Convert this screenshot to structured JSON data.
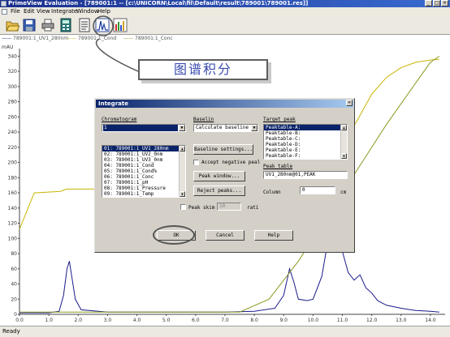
{
  "window": {
    "title": "PrimeView Evaluation - [789001:1 -- [c:\\UNICORN\\Local\\fil\\Default\\result\\789001\\789001.res]]",
    "controls": [
      "_",
      "□",
      "×"
    ]
  },
  "menubar": {
    "items": [
      "File",
      "Edit",
      "View",
      "Integrate",
      "Window",
      "Help"
    ]
  },
  "toolbar": {
    "buttons": [
      "open-folder",
      "save",
      "print",
      "calculator",
      "notes",
      "integrate-peak",
      "report-colors"
    ]
  },
  "legend": {
    "items": [
      "789001:1_UV1_280nm",
      "789001:1_Cond",
      "789001:1_Conc"
    ]
  },
  "chart_data": {
    "type": "line",
    "ylabel": "mAU",
    "yticks": [
      "0",
      "20",
      "40",
      "60",
      "80",
      "100",
      "120",
      "140",
      "160",
      "180",
      "200",
      "220",
      "240",
      "260",
      "280",
      "300",
      "320",
      "340"
    ],
    "xticks": [
      "0.0",
      "1.0",
      "2.0",
      "3.0",
      "4.0",
      "5.0",
      "6.0",
      "7.0",
      "8.0",
      "9.0",
      "10.0",
      "11.0",
      "12.0",
      "13.0",
      "14.0"
    ],
    "xlim": [
      0,
      14.5
    ],
    "ylim": [
      0,
      350
    ],
    "series": [
      {
        "name": "789001:1_UV1_280nm",
        "color": "#1a1a8c",
        "x": [
          0,
          1.0,
          1.35,
          1.5,
          1.62,
          1.7,
          1.78,
          1.9,
          2.1,
          3,
          5,
          7,
          8,
          8.7,
          9.0,
          9.2,
          9.35,
          9.5,
          9.8,
          10.0,
          10.3,
          10.5,
          10.75,
          10.85,
          10.95,
          11.2,
          11.4,
          11.6,
          11.8,
          12.0,
          12.2,
          12.5,
          13.0,
          13.5,
          14.0,
          14.3
        ],
        "y": [
          2,
          2,
          4,
          25,
          60,
          70,
          50,
          20,
          6,
          3,
          3,
          3,
          4,
          8,
          25,
          60,
          42,
          20,
          18,
          20,
          50,
          95,
          140,
          125,
          90,
          55,
          45,
          52,
          35,
          28,
          18,
          12,
          8,
          5,
          4,
          3
        ]
      },
      {
        "name": "789001:1_Cond",
        "color": "#c8b400",
        "x": [
          0,
          0.5,
          1.4,
          1.6,
          3,
          6,
          8.5,
          9.5,
          10.5,
          11.0,
          11.5,
          12.0,
          12.5,
          13.0,
          13.5,
          14.0,
          14.3
        ],
        "y": [
          112,
          160,
          162,
          165,
          165,
          168,
          170,
          175,
          200,
          225,
          255,
          290,
          312,
          325,
          332,
          335,
          336
        ]
      },
      {
        "name": "789001:1_Conc",
        "color": "#8a9a20",
        "x": [
          0,
          7.5,
          8.5,
          9.5,
          10.5,
          11.5,
          12.5,
          13.5,
          14.0,
          14.3
        ],
        "y": [
          3,
          3,
          20,
          70,
          130,
          190,
          250,
          305,
          332,
          340
        ]
      }
    ]
  },
  "callout": {
    "text": "图谱积分"
  },
  "dialog": {
    "title": "Integrate",
    "close": "×",
    "chromatogram_label": "Chromatogram",
    "chromatogram_value": "1",
    "curves": [
      "01: 789001:1_UV1_280nm",
      "02: 789001:1_UV2_0nm",
      "03: 789001:1_UV3_0nm",
      "04: 789001:1_Cond",
      "05: 789001:1_Cond%",
      "06: 789001:1_Conc",
      "07: 789001:1_pH",
      "08: 789001:1_Pressure",
      "09: 789001:1_Temp"
    ],
    "baseline_label": "Baselin",
    "baseline_value": "Calculate baseline",
    "baseline_settings": "Baseline settings...",
    "accept_negative": "Accept negative peal",
    "peak_window": "Peak window...",
    "reject_peaks": "Reject peaks...",
    "peak_skim": "Peak skim",
    "peak_skim_value": "10",
    "ratio_label": "rati",
    "target_peak_label": "Target peak",
    "target_peaks": [
      "Peaktable-A:",
      "Peaktable-B:",
      "Peaktable-C:",
      "Peaktable-D:",
      "Peaktable-E:",
      "Peaktable-F:"
    ],
    "peak_table_label": "Peak table",
    "peak_table_value": "UV1_280nm@01,PEAK",
    "column_label": "Column",
    "column_value": "0",
    "column_unit": "cm",
    "ok": "OK",
    "cancel": "Cancel",
    "help": "Help"
  },
  "status": {
    "text": "Ready"
  }
}
